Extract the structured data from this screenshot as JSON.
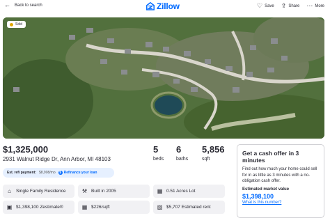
{
  "header": {
    "back_label": "Back to search",
    "logo_text": "Zillow",
    "actions": [
      {
        "label": "Save",
        "icon": "heart-icon"
      },
      {
        "label": "Share",
        "icon": "share-icon"
      },
      {
        "label": "More",
        "icon": "more-icon"
      }
    ]
  },
  "photo": {
    "badge": "Sold"
  },
  "listing": {
    "price": "$1,325,000",
    "address": "2931 Walnut Ridge Dr, Ann Arbor, MI 48103",
    "beds_value": "5",
    "beds_label": "beds",
    "baths_value": "6",
    "baths_label": "baths",
    "sqft_value": "5,856",
    "sqft_label": "sqft"
  },
  "refi": {
    "label": "Est. refi payment:",
    "amount": "$8,908/mo",
    "cta": "Refinance your loan"
  },
  "facts": [
    {
      "icon": "home-icon",
      "text": "Single Family Residence"
    },
    {
      "icon": "hammer-icon",
      "text": "Built in 2005"
    },
    {
      "icon": "lot-icon",
      "text": "0.51 Acres Lot"
    },
    {
      "icon": "zestimate-icon",
      "text": "$1,398,100 Zestimate®"
    },
    {
      "icon": "ruler-icon",
      "text": "$226/sqft"
    },
    {
      "icon": "hoa-icon",
      "text": "$5,707 Estimated rent"
    }
  ],
  "cash_offer": {
    "title": "Get a cash offer in 3 minutes",
    "body": "Find out how much your home could sell for in as little as 3 minutes with a no-obligation cash offer.",
    "value_label": "Estimated market value",
    "value": "$1,398,100",
    "link": "What is this number?"
  },
  "colors": {
    "accent": "#006aff",
    "sold_dot": "#e0a800"
  }
}
